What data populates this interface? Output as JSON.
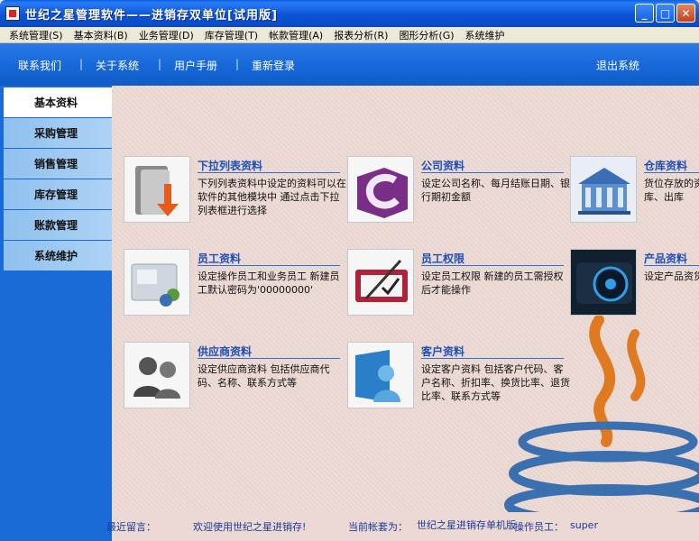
{
  "window": {
    "title": "世纪之星管理软件——进销存双单位[试用版]"
  },
  "menubar": [
    "系统管理(S)",
    "基本资料(B)",
    "业务管理(D)",
    "库存管理(T)",
    "帐款管理(A)",
    "报表分析(R)",
    "图形分析(G)",
    "系统维护"
  ],
  "topnav": {
    "links": [
      "联系我们",
      "关于系统",
      "用户手册",
      "重新登录"
    ],
    "separator": "|",
    "exit": "退出系统"
  },
  "sidebar": {
    "items": [
      "基本资料",
      "采购管理",
      "销售管理",
      "库存管理",
      "账款管理",
      "系统维护"
    ],
    "active_index": 0
  },
  "tiles": [
    {
      "title": "下拉列表资料",
      "desc": "下列列表资料中设定的资料可以在软件的其他模块中 通过点击下拉列表框进行选择",
      "icon": "folder-arrow-icon"
    },
    {
      "title": "公司资料",
      "desc": "设定公司名称、每月结账日期、银行期初金额",
      "icon": "company-icon"
    },
    {
      "title": "仓库资料",
      "desc": "货位存放的资料是虚拟的仓库入库、出库",
      "icon": "warehouse-icon"
    },
    {
      "title": "员工资料",
      "desc": "设定操作员工和业务员工 新建员工默认密码为'00000000'",
      "icon": "employee-icon"
    },
    {
      "title": "员工权限",
      "desc": "设定员工权限 新建的员工需授权后才能操作",
      "icon": "permission-icon"
    },
    {
      "title": "产品资料",
      "desc": "设定产品资货号、品名节、尺码组",
      "icon": "product-icon"
    },
    {
      "title": "供应商资料",
      "desc": "设定供应商资料 包括供应商代码、名称、联系方式等",
      "icon": "supplier-icon"
    },
    {
      "title": "客户资料",
      "desc": "设定客户资料 包括客户代码、客户名称、折扣率、换货比率、退货比率、联系方式等",
      "icon": "customer-icon"
    }
  ],
  "status": {
    "msg_label": "最近留言：",
    "msg_text": "欢迎使用世纪之星进销存!",
    "account_label": "当前帐套为：",
    "account_value": "世纪之星进销存单机版",
    "user_label": "操作员工：",
    "user_value": "super"
  }
}
